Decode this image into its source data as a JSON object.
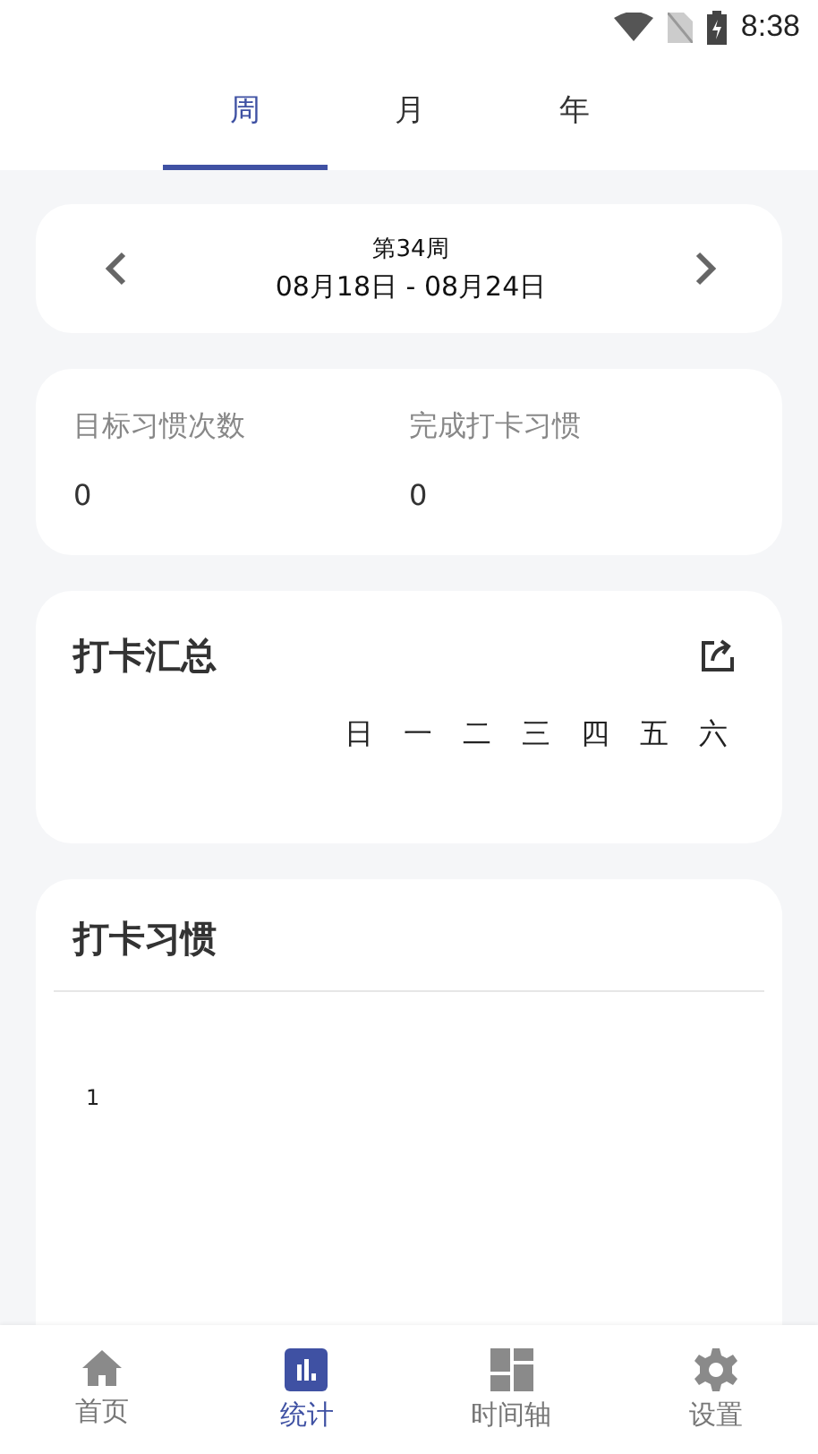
{
  "status_bar": {
    "time": "8:38"
  },
  "tabs": [
    {
      "label": "周",
      "selected": true
    },
    {
      "label": "月",
      "selected": false
    },
    {
      "label": "年",
      "selected": false
    }
  ],
  "week_nav": {
    "week": "第34周",
    "range": "08月18日 - 08月24日"
  },
  "stats": [
    {
      "label": "目标习惯次数",
      "value": "0"
    },
    {
      "label": "完成打卡习惯",
      "value": "0"
    }
  ],
  "summary": {
    "title": "打卡汇总",
    "weekdays": [
      "日",
      "一",
      "二",
      "三",
      "四",
      "五",
      "六"
    ]
  },
  "habits": {
    "title": "打卡习惯",
    "axis_label": "1"
  },
  "bottom_nav": [
    {
      "label": "首页",
      "selected": false
    },
    {
      "label": "统计",
      "selected": true
    },
    {
      "label": "时间轴",
      "selected": false
    },
    {
      "label": "设置",
      "selected": false
    }
  ]
}
